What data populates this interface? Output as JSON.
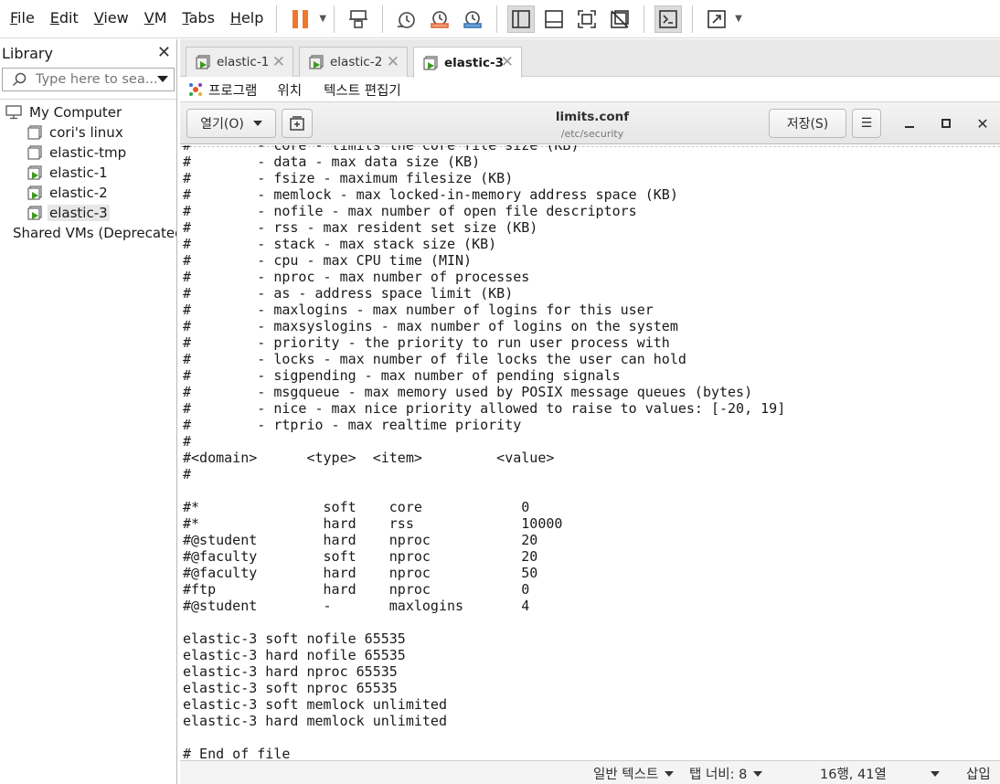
{
  "menubar": {
    "items": [
      {
        "label_u": "F",
        "label_rest": "ile"
      },
      {
        "label_u": "E",
        "label_rest": "dit"
      },
      {
        "label_u": "V",
        "label_rest": "iew"
      },
      {
        "label_u": "V",
        "label_rest": "M"
      },
      {
        "label_u": "T",
        "label_rest": "abs"
      },
      {
        "label_u": "H",
        "label_rest": "elp"
      }
    ]
  },
  "colors": {
    "pause_orange": "#f0782a",
    "vm_green": "#3d9a1f",
    "accent_gray": "#dcdcdc"
  },
  "library": {
    "title": "Library",
    "close_glyph": "✕",
    "search_placeholder": "Type here to sea...",
    "tree": [
      {
        "label": "My Computer",
        "icon": "monitor-icon"
      },
      {
        "label": "cori's linux",
        "icon": "vm-stopped-icon"
      },
      {
        "label": "elastic-tmp",
        "icon": "vm-stopped-icon"
      },
      {
        "label": "elastic-1",
        "icon": "vm-running-icon"
      },
      {
        "label": "elastic-2",
        "icon": "vm-running-icon"
      },
      {
        "label": "elastic-3",
        "icon": "vm-running-icon",
        "selected": true
      },
      {
        "label": "Shared VMs (Deprecated)",
        "icon": "shared-vms-icon"
      }
    ]
  },
  "tabs": [
    {
      "label": "elastic-1",
      "close": "✕"
    },
    {
      "label": "elastic-2",
      "close": "✕"
    },
    {
      "label": "elastic-3",
      "close": "✕",
      "active": true
    }
  ],
  "gnome": {
    "programs": "프로그램",
    "places": "위치",
    "text_editor": "텍스트 편집기"
  },
  "gedit": {
    "open_label": "열기(O)",
    "save_label": "저장(S)",
    "title": "limits.conf",
    "subtitle": "/etc/security",
    "menu_glyph": "☰",
    "minimize_glyph": "⎯",
    "maximize_glyph": "■",
    "close_glyph": "✕"
  },
  "file_lines": [
    "#        - core - limits the core file size (KB)",
    "#        - data - max data size (KB)",
    "#        - fsize - maximum filesize (KB)",
    "#        - memlock - max locked-in-memory address space (KB)",
    "#        - nofile - max number of open file descriptors",
    "#        - rss - max resident set size (KB)",
    "#        - stack - max stack size (KB)",
    "#        - cpu - max CPU time (MIN)",
    "#        - nproc - max number of processes",
    "#        - as - address space limit (KB)",
    "#        - maxlogins - max number of logins for this user",
    "#        - maxsyslogins - max number of logins on the system",
    "#        - priority - the priority to run user process with",
    "#        - locks - max number of file locks the user can hold",
    "#        - sigpending - max number of pending signals",
    "#        - msgqueue - max memory used by POSIX message queues (bytes)",
    "#        - nice - max nice priority allowed to raise to values: [-20, 19]",
    "#        - rtprio - max realtime priority",
    "#",
    "#<domain>      <type>  <item>         <value>",
    "#",
    "",
    "#*               soft    core            0",
    "#*               hard    rss             10000",
    "#@student        hard    nproc           20",
    "#@faculty        soft    nproc           20",
    "#@faculty        hard    nproc           50",
    "#ftp             hard    nproc           0",
    "#@student        -       maxlogins       4",
    "",
    "elastic-3 soft nofile 65535",
    "elastic-3 hard nofile 65535",
    "elastic-3 hard nproc 65535",
    "elastic-3 soft nproc 65535",
    "elastic-3 soft memlock unlimited",
    "elastic-3 hard memlock unlimited",
    "",
    "# End of file"
  ],
  "statusbar": {
    "language": "일반 텍스트",
    "tab_width": "탭 너비: 8",
    "position": "16행, 41열",
    "insert_mode": "삽입"
  }
}
